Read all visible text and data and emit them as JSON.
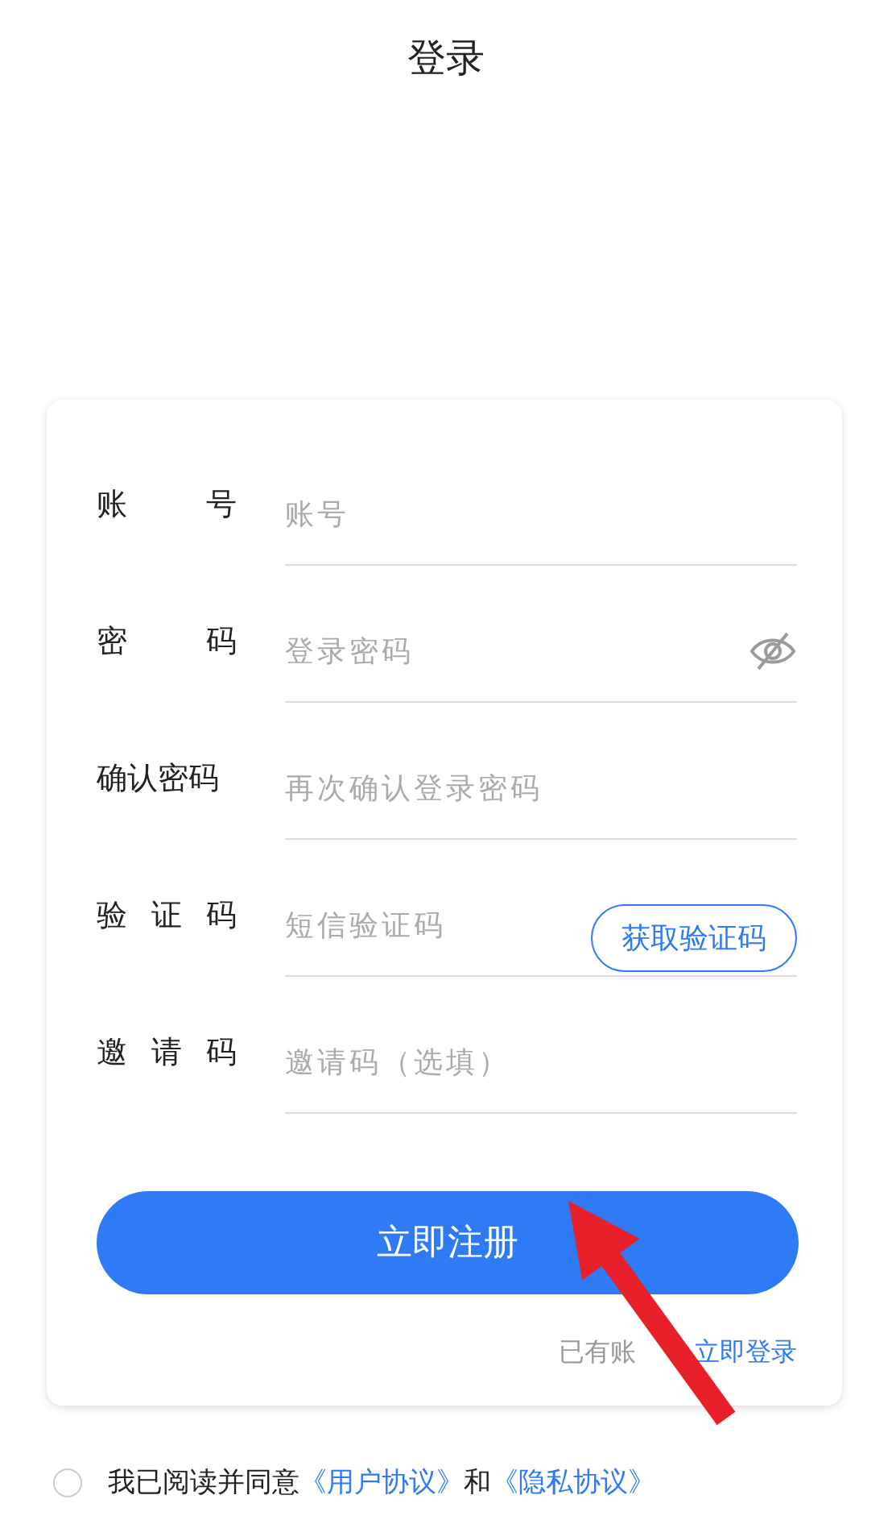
{
  "title": "登录",
  "fields": [
    {
      "label": "账　号",
      "placeholder": "账号",
      "kind": "text"
    },
    {
      "label": "密　码",
      "placeholder": "登录密码",
      "kind": "password"
    },
    {
      "label": "确认密码",
      "placeholder": "再次确认登录密码",
      "kind": "text"
    },
    {
      "label": "验证码",
      "placeholder": "短信验证码",
      "kind": "code",
      "action": "获取验证码"
    },
    {
      "label": "邀请码",
      "placeholder": "邀请码（选填）",
      "kind": "text"
    }
  ],
  "submit": "立即注册",
  "login_prompt": "已有账",
  "login_link": "立即登录",
  "agreement": {
    "checked": false,
    "text": "我已阅读并同意",
    "link_1": "《用户协议》",
    "joiner": "和",
    "link_2": "《隐私协议》"
  },
  "annotation": {
    "kind": "arrow"
  }
}
